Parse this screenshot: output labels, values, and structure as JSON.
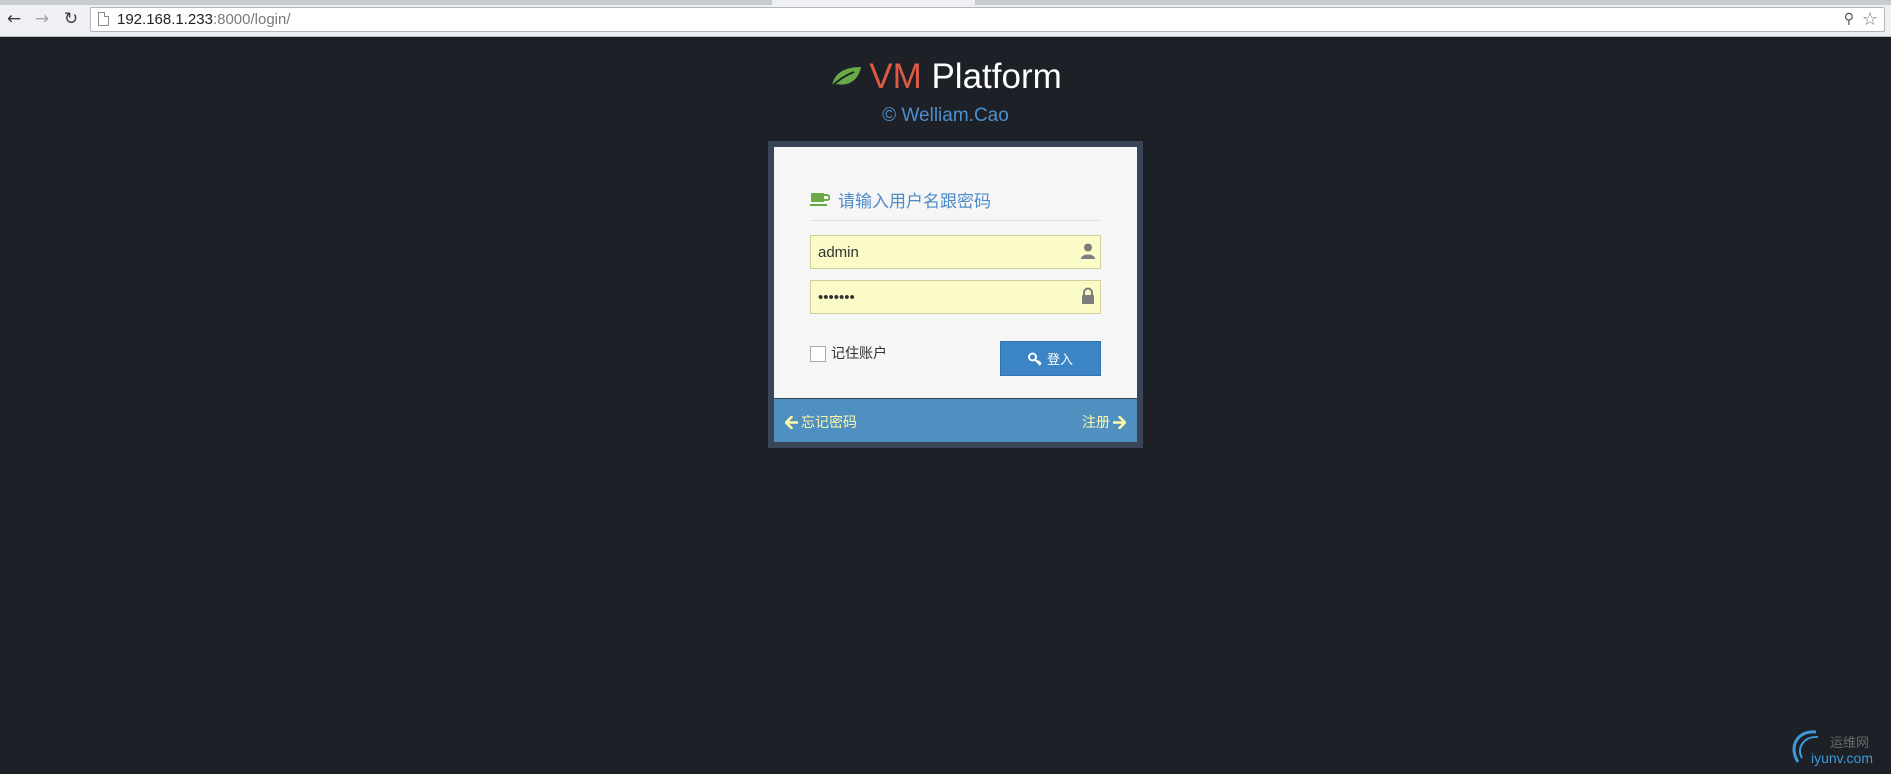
{
  "browser": {
    "url_host": "192.168.1.233",
    "url_rest": ":8000/login/"
  },
  "brand": {
    "vm": "VM",
    "platform": "Platform",
    "copyright": "© Welliam.Cao",
    "leaf_color": "#69aa46"
  },
  "login": {
    "title": "请输入用户名跟密码",
    "username_value": "admin",
    "password_value": "•••••••",
    "remember_label": "记住账户",
    "submit_label": "登入"
  },
  "footer": {
    "forgot_label": "忘记密码",
    "register_label": "注册"
  },
  "watermark": {
    "cn": "运维网",
    "en": "iyunv.com"
  },
  "colors": {
    "background": "#1d2026",
    "accent_red": "#dd5a43",
    "accent_blue": "#4c8fcf",
    "footer_blue": "#5090c1",
    "link_yellow": "#fef9a8"
  }
}
